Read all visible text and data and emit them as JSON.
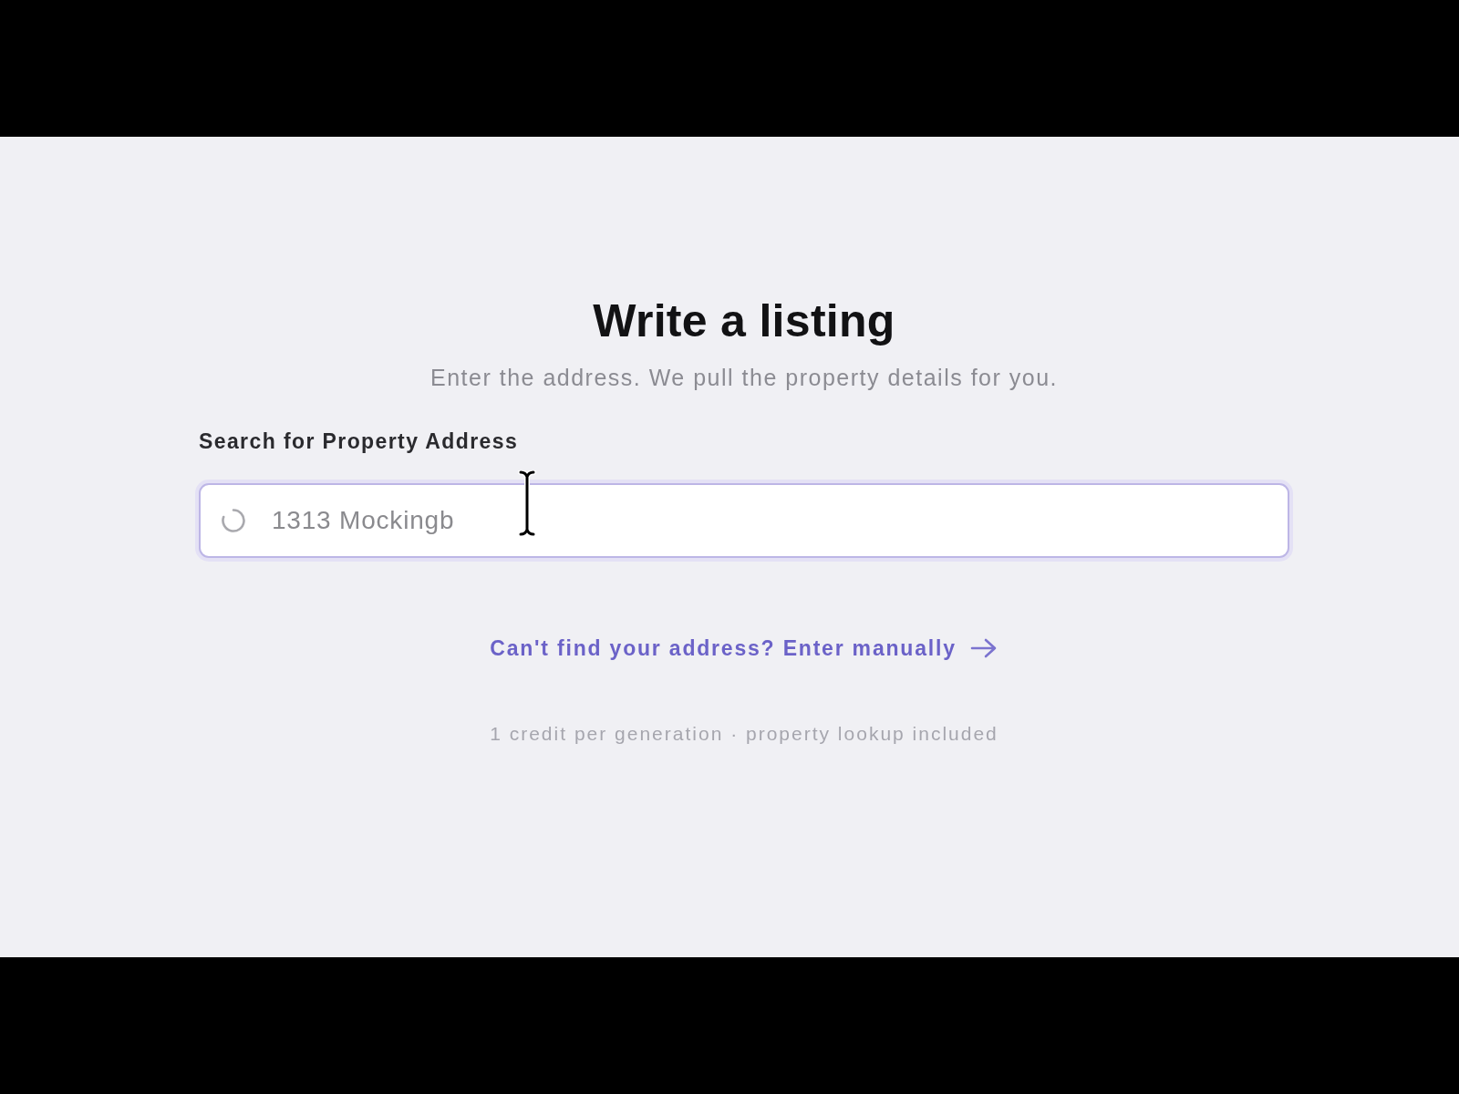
{
  "heading": {
    "title": "Write a listing",
    "subtitle": "Enter the address. We pull the property details for you."
  },
  "address_search": {
    "label": "Search for Property Address",
    "value": "1313 Mockingb",
    "loading": true,
    "focused": true
  },
  "manual_entry_link": {
    "label": "Can't find your address? Enter manually"
  },
  "credit_note": "1 credit per generation · property lookup included"
}
